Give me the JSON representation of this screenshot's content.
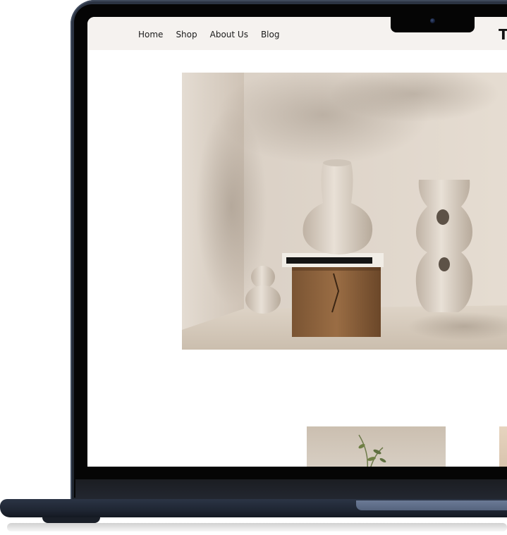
{
  "site": {
    "nav": [
      {
        "label": "Home"
      },
      {
        "label": "Shop"
      },
      {
        "label": "About Us"
      },
      {
        "label": "Blog"
      }
    ],
    "logo_text": "T"
  },
  "hero": {
    "image_icon": "ceramic-vases-photo"
  },
  "products": [
    {
      "image_icon": "plant-photo"
    },
    {
      "image_icon": "product-photo"
    }
  ],
  "colors": {
    "header_bg": "#f5f2ef",
    "laptop_body": "#2c3443",
    "bezel": "#050505"
  }
}
